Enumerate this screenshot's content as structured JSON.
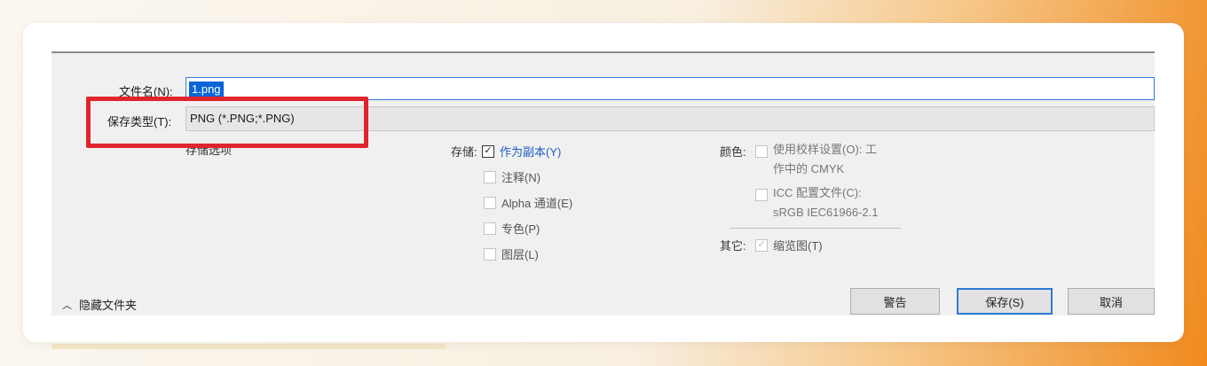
{
  "dialog": {
    "file_name": {
      "label": "文件名(N):",
      "value": "1.png"
    },
    "save_type": {
      "label": "保存类型(T):",
      "value": "PNG (*.PNG;*.PNG)"
    },
    "storage_options_heading": "存储选项",
    "storage": {
      "label": "存储:",
      "options": [
        {
          "label": "作为副本(Y)",
          "checked": true
        },
        {
          "label": "注释(N)",
          "checked": false
        },
        {
          "label": "Alpha 通道(E)",
          "checked": false
        },
        {
          "label": "专色(P)",
          "checked": false
        },
        {
          "label": "图层(L)",
          "checked": false
        }
      ]
    },
    "color": {
      "label": "颜色:",
      "proof_line1": "使用校样设置(O): 工",
      "proof_line2": "作中的 CMYK",
      "icc_line1": "ICC 配置文件(C):",
      "icc_line2": "sRGB IEC61966-2.1"
    },
    "other": {
      "label": "其它:",
      "thumbnail": "缩览图(T)"
    },
    "hide_folders": "隐藏文件夹",
    "buttons": {
      "warning": "警告",
      "save": "保存(S)",
      "cancel": "取消"
    }
  },
  "colors": {
    "highlight": "#e0242c",
    "selection": "#0a64d8",
    "accent_border": "#2f7bd3"
  }
}
